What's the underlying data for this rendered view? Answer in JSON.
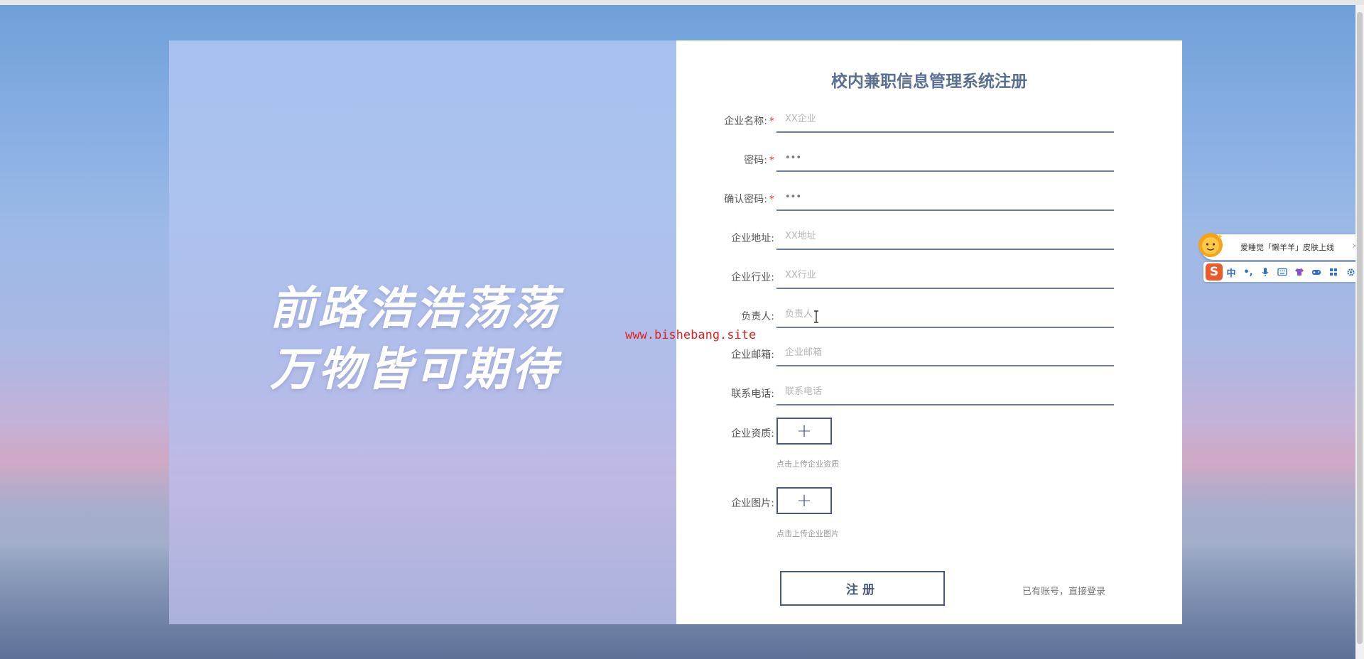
{
  "slogan": {
    "line1": "前路浩浩荡荡",
    "line2": "万物皆可期待"
  },
  "watermark": "www.bishebang.site",
  "form": {
    "title": "校内兼职信息管理系统注册",
    "required_mark": "*",
    "fields": [
      {
        "label": "企业名称:",
        "placeholder": "XX企业",
        "required": true
      },
      {
        "label": "密码:",
        "value": "•••",
        "required": true
      },
      {
        "label": "确认密码:",
        "value": "•••",
        "required": true
      },
      {
        "label": "企业地址:",
        "placeholder": "XX地址",
        "required": false
      },
      {
        "label": "企业行业:",
        "placeholder": "XX行业",
        "required": false
      },
      {
        "label": "负责人:",
        "placeholder": "负责人",
        "required": false
      },
      {
        "label": "企业邮箱:",
        "placeholder": "企业邮箱",
        "required": false
      },
      {
        "label": "联系电话:",
        "placeholder": "联系电话",
        "required": false
      }
    ],
    "uploads": [
      {
        "label": "企业资质:",
        "icon": "plus-icon",
        "hint": "点击上传企业资质"
      },
      {
        "label": "企业图片:",
        "icon": "plus-icon",
        "hint": "点击上传企业图片"
      }
    ],
    "register_button": "注册",
    "login_link": "已有账号，直接登录"
  },
  "ime": {
    "promo_text": "爱睡觉「懒羊羊」皮肤上线",
    "close": "×",
    "logo": "S",
    "mode": "中",
    "punct": "•,",
    "icons": [
      "microphone-icon",
      "keyboard-icon",
      "shirt-icon",
      "gamepad-icon",
      "grid-icon",
      "gear-icon"
    ]
  },
  "colors": {
    "accent": "#4a5877",
    "title": "#5b6f93",
    "required": "#e0463c",
    "watermark": "#e0211b"
  }
}
